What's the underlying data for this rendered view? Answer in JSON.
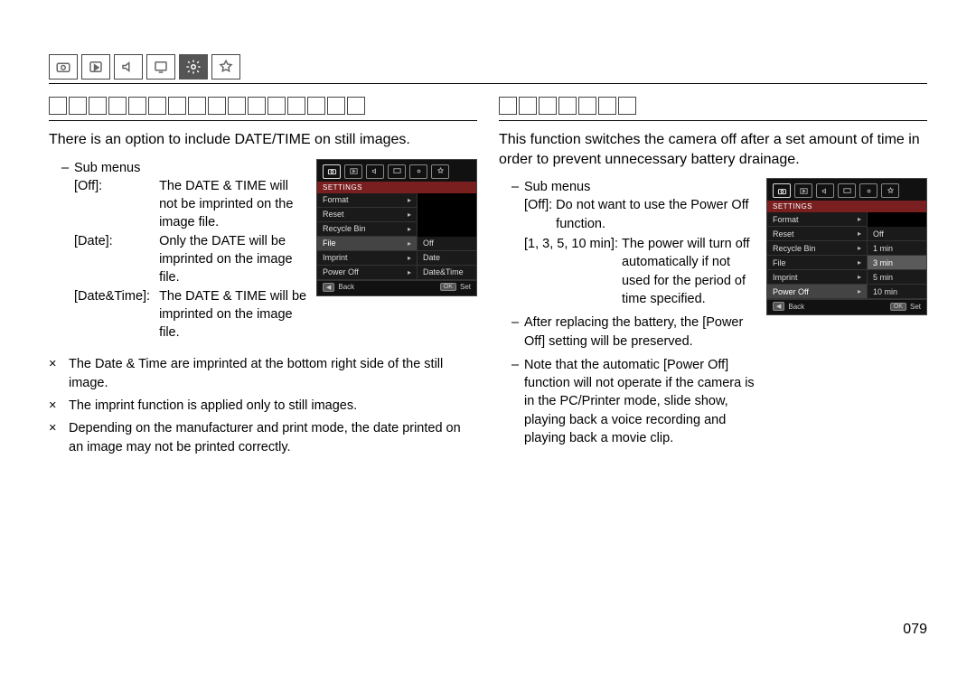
{
  "page_number": "079",
  "tabs": {
    "active_index": 3
  },
  "left": {
    "intro": "There is an option to include DATE/TIME on still images.",
    "submenus_label": "Sub menus",
    "items": {
      "off_key": "[Off]:",
      "off_val": "The DATE & TIME will not be imprinted on the image ﬁle.",
      "date_key": "[Date]:",
      "date_val": "Only the DATE will be imprinted on the image ﬁle.",
      "dt_key": "[Date&Time]:",
      "dt_val": "The DATE & TIME will be imprinted on the image ﬁle."
    },
    "notes": [
      "The Date & Time are imprinted at the bottom right side of the still image.",
      "The imprint function is applied only to still images.",
      "Depending on the manufacturer and print mode, the date printed on an image may not be printed correctly."
    ],
    "cam": {
      "title": "SETTINGS",
      "menu": [
        "Format",
        "Reset",
        "Recycle Bin",
        "File",
        "Imprint",
        "Power Off"
      ],
      "selected_index": 3,
      "options": [
        "Off",
        "Date",
        "Date&Time"
      ],
      "footer_back": "Back",
      "footer_back_key": "◀",
      "footer_set": "Set",
      "footer_set_key": "OK"
    }
  },
  "right": {
    "intro": "This function switches the camera off after a set amount of time in order to prevent unnecessary battery drainage.",
    "submenus_label": "Sub menus",
    "off_key": "[Off]:",
    "off_val": "Do not want to use the Power Off function.",
    "times_key": "[1, 3, 5, 10 min]:",
    "times_val": "The power will turn off automatically if not used for the period of time speciﬁed.",
    "after_battery": "After replacing the battery, the [Power Off] setting will be preserved.",
    "note": "Note that the automatic [Power Off] function will not operate if the camera is in the PC/Printer mode, slide show, playing back a voice recording and playing back a movie clip.",
    "cam": {
      "title": "SETTINGS",
      "menu": [
        "Format",
        "Reset",
        "Recycle Bin",
        "File",
        "Imprint",
        "Power Off"
      ],
      "selected_index": 5,
      "options": [
        "Off",
        "1 min",
        "3 min",
        "5 min",
        "10 min"
      ],
      "option_selected_index": 2,
      "footer_back": "Back",
      "footer_back_key": "◀",
      "footer_set": "Set",
      "footer_set_key": "OK"
    }
  }
}
